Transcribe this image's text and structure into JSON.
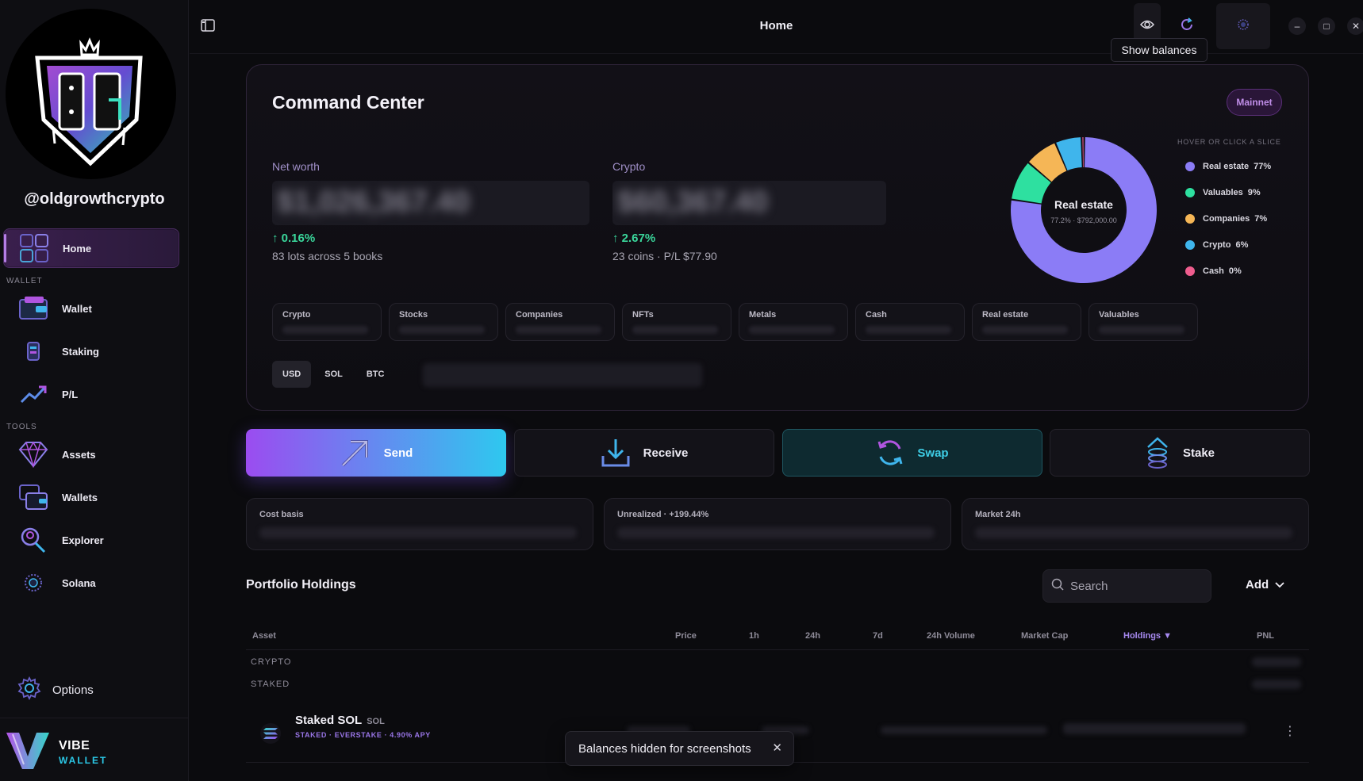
{
  "window": {
    "title": "Home",
    "tooltip": "Show balances"
  },
  "profile": {
    "handle": "@oldgrowthcrypto"
  },
  "sidebar": {
    "home": "Home",
    "wallet_section": "WALLET",
    "wallet": "Wallet",
    "staking": "Staking",
    "pl": "P/L",
    "tools_section": "TOOLS",
    "assets": "Assets",
    "wallets": "Wallets",
    "explorer": "Explorer",
    "solana": "Solana",
    "options": "Options",
    "brand_line1": "VIBE",
    "brand_line2": "WALLET"
  },
  "command_center": {
    "title": "Command Center",
    "network": "Mainnet",
    "net_worth": {
      "label": "Net worth",
      "value": "$1,026,367.40",
      "change": "↑ 0.16%",
      "sub": "83 lots across 5 books"
    },
    "crypto": {
      "label": "Crypto",
      "value": "$60,367.40",
      "change": "↑ 2.67%",
      "sub": "23 coins  ·  P/L $77.90"
    },
    "chips": [
      "Crypto",
      "Stocks",
      "Companies",
      "NFTs",
      "Metals",
      "Cash",
      "Real estate",
      "Valuables"
    ],
    "currencies": [
      "USD",
      "SOL",
      "BTC"
    ],
    "active_currency": "USD"
  },
  "allocation": {
    "hint": "HOVER OR CLICK A SLICE",
    "center_label": "Real estate",
    "center_sub": "77.2%  ·  $792,000.00",
    "slices": [
      {
        "name": "Real estate",
        "pct": "77%",
        "value": 77.2,
        "color": "#8b7cf6"
      },
      {
        "name": "Valuables",
        "pct": "9%",
        "value": 9.0,
        "color": "#2ee0a0"
      },
      {
        "name": "Companies",
        "pct": "7%",
        "value": 7.3,
        "color": "#f5b656"
      },
      {
        "name": "Crypto",
        "pct": "6%",
        "value": 5.9,
        "color": "#3fb5ec"
      },
      {
        "name": "Cash",
        "pct": "0%",
        "value": 0.6,
        "color": "#ef5d8e"
      }
    ]
  },
  "actions": {
    "send": "Send",
    "receive": "Receive",
    "swap": "Swap",
    "stake": "Stake"
  },
  "metrics": {
    "cost_basis": "Cost basis",
    "unrealized": "Unrealized  ·  +199.44%",
    "market_24h": "Market 24h"
  },
  "holdings": {
    "title": "Portfolio Holdings",
    "search_placeholder": "Search",
    "add": "Add",
    "columns": {
      "asset": "Asset",
      "price": "Price",
      "h1": "1h",
      "h24": "24h",
      "d7": "7d",
      "volume": "24h Volume",
      "mcap": "Market Cap",
      "holdings": "Holdings ▼",
      "pnl": "PNL"
    },
    "groups": {
      "crypto": "CRYPTO",
      "staked": "STAKED"
    },
    "rows": [
      {
        "name": "Staked SOL",
        "ticker": "SOL",
        "meta": "STAKED · EVERSTAKE · 4.90% APY"
      }
    ]
  },
  "toast": {
    "message": "Balances hidden for screenshots"
  }
}
